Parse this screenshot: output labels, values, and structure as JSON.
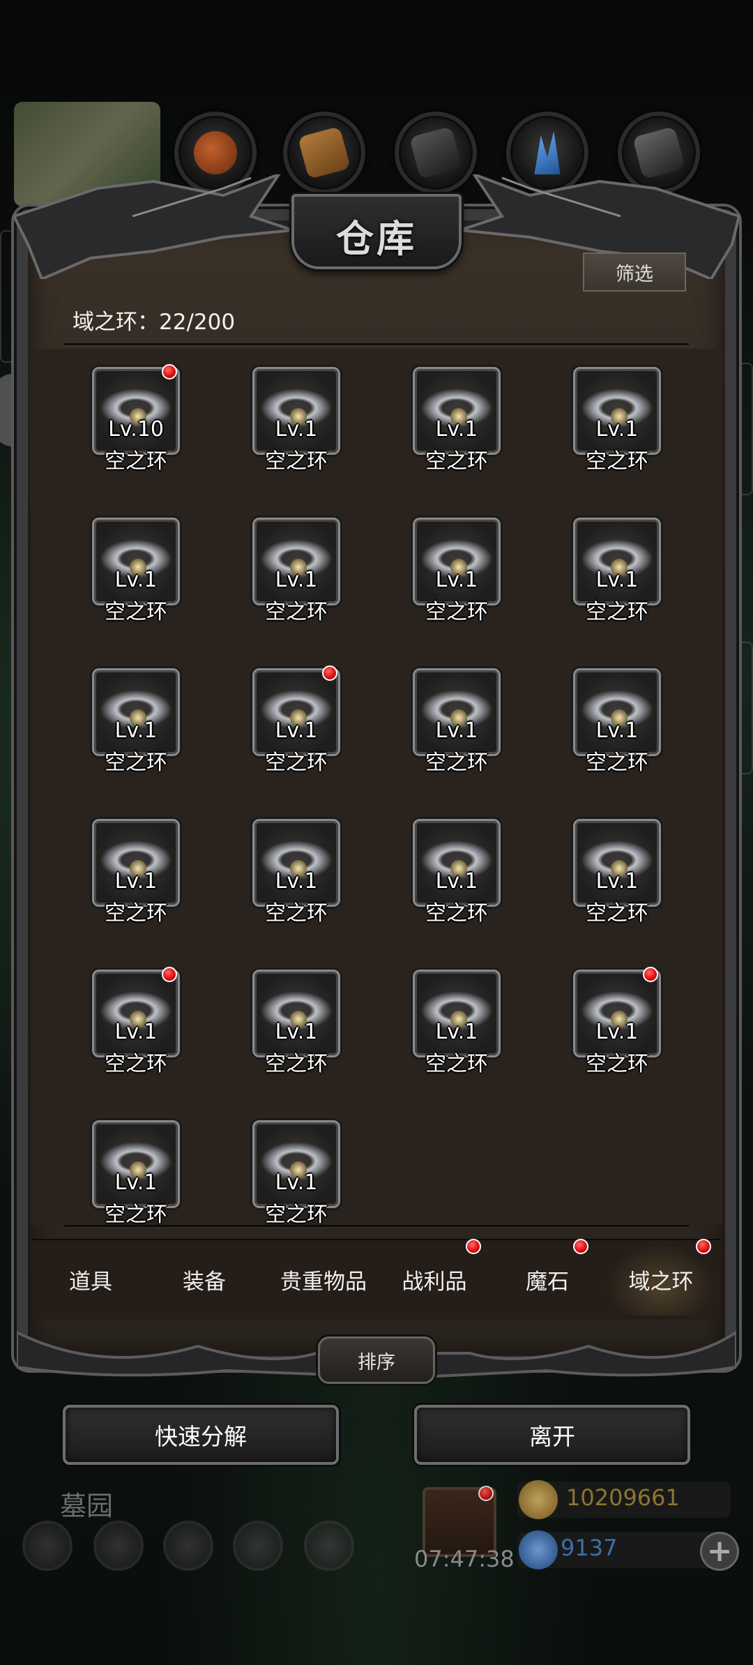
{
  "window": {
    "title": "仓库"
  },
  "toolbar": {
    "filter_label": "筛选"
  },
  "capacity": {
    "text": "域之环：22/200"
  },
  "items": [
    {
      "level": "Lv.10",
      "name": "空之环",
      "new": true
    },
    {
      "level": "Lv.1",
      "name": "空之环",
      "new": false
    },
    {
      "level": "Lv.1",
      "name": "空之环",
      "new": false
    },
    {
      "level": "Lv.1",
      "name": "空之环",
      "new": false
    },
    {
      "level": "Lv.1",
      "name": "空之环",
      "new": false
    },
    {
      "level": "Lv.1",
      "name": "空之环",
      "new": false
    },
    {
      "level": "Lv.1",
      "name": "空之环",
      "new": false
    },
    {
      "level": "Lv.1",
      "name": "空之环",
      "new": false
    },
    {
      "level": "Lv.1",
      "name": "空之环",
      "new": false
    },
    {
      "level": "Lv.1",
      "name": "空之环",
      "new": true
    },
    {
      "level": "Lv.1",
      "name": "空之环",
      "new": false
    },
    {
      "level": "Lv.1",
      "name": "空之环",
      "new": false
    },
    {
      "level": "Lv.1",
      "name": "空之环",
      "new": false
    },
    {
      "level": "Lv.1",
      "name": "空之环",
      "new": false
    },
    {
      "level": "Lv.1",
      "name": "空之环",
      "new": false
    },
    {
      "level": "Lv.1",
      "name": "空之环",
      "new": false
    },
    {
      "level": "Lv.1",
      "name": "空之环",
      "new": true
    },
    {
      "level": "Lv.1",
      "name": "空之环",
      "new": false
    },
    {
      "level": "Lv.1",
      "name": "空之环",
      "new": false
    },
    {
      "level": "Lv.1",
      "name": "空之环",
      "new": true
    },
    {
      "level": "Lv.1",
      "name": "空之环",
      "new": false
    },
    {
      "level": "Lv.1",
      "name": "空之环",
      "new": false
    }
  ],
  "tabs": [
    {
      "label": "道具",
      "badge": false,
      "active": false
    },
    {
      "label": "装备",
      "badge": false,
      "active": false
    },
    {
      "label": "贵重物品",
      "badge": false,
      "active": false
    },
    {
      "label": "战利品",
      "badge": true,
      "active": false
    },
    {
      "label": "魔石",
      "badge": true,
      "active": false
    },
    {
      "label": "域之环",
      "badge": true,
      "active": true
    }
  ],
  "actions": {
    "sort_label": "排序",
    "quick_decompose_label": "快速分解",
    "leave_label": "离开"
  },
  "hud": {
    "location": "墓园",
    "timer": "07:47:38",
    "gold": "10209661",
    "gems": "9137",
    "gold_color": "#c8a24a",
    "gem_color": "#4a90d9"
  },
  "icons": {
    "resources": [
      "meat-icon",
      "wood-icon",
      "iron-icon",
      "crystal-icon",
      "stone-icon"
    ],
    "hud": [
      "settings-icon",
      "achievement-icon",
      "rank-icon",
      "mail-icon",
      "shop-icon"
    ]
  },
  "colors": {
    "badge": "#e01010",
    "panel": "#2f2821"
  }
}
